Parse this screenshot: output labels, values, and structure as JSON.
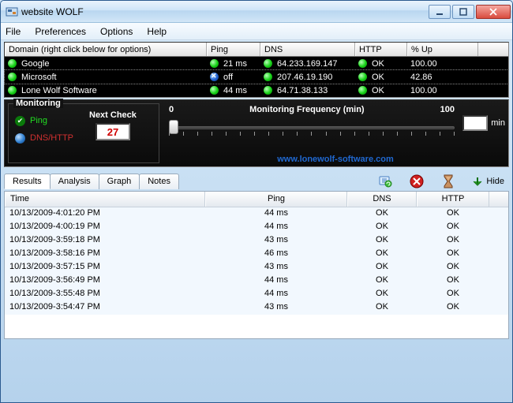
{
  "window": {
    "title": "website WOLF"
  },
  "menu": {
    "file": "File",
    "preferences": "Preferences",
    "options": "Options",
    "help": "Help"
  },
  "top_header": {
    "domain": "Domain   (right click below for options)",
    "ping": "Ping",
    "dns": "DNS",
    "http": "HTTP",
    "up": "% Up"
  },
  "sites": [
    {
      "name": "Google",
      "ping_status": "ok",
      "ping": "21 ms",
      "dns_status": "ok",
      "dns": "64.233.169.147",
      "http_status": "ok",
      "http": "OK",
      "up": "100.00",
      "selected": false
    },
    {
      "name": "Microsoft",
      "ping_status": "off",
      "ping": "off",
      "dns_status": "ok",
      "dns": "207.46.19.190",
      "http_status": "ok",
      "http": "OK",
      "up": "42.86",
      "selected": true
    },
    {
      "name": "Lone Wolf Software",
      "ping_status": "ok",
      "ping": "44 ms",
      "dns_status": "ok",
      "dns": "64.71.38.133",
      "http_status": "ok",
      "http": "OK",
      "up": "100.00",
      "selected": false
    }
  ],
  "monitoring": {
    "title": "Monitoring",
    "ping_label": "Ping",
    "dnshttp_label": "DNS/HTTP",
    "next_check_label": "Next Check",
    "next_check_value": "27"
  },
  "frequency": {
    "title": "Monitoring Frequency (min)",
    "min_label": "0",
    "max_label": "100",
    "value": "1",
    "unit": "min"
  },
  "link": "www.lonewolf-software.com",
  "tabs": {
    "results": "Results",
    "analysis": "Analysis",
    "graph": "Graph",
    "notes": "Notes"
  },
  "hide_label": "Hide",
  "results_header": {
    "time": "Time",
    "ping": "Ping",
    "dns": "DNS",
    "http": "HTTP"
  },
  "results": [
    {
      "time": "10/13/2009-4:01:20 PM",
      "ping": "44 ms",
      "dns": "OK",
      "http": "OK"
    },
    {
      "time": "10/13/2009-4:00:19 PM",
      "ping": "44 ms",
      "dns": "OK",
      "http": "OK"
    },
    {
      "time": "10/13/2009-3:59:18 PM",
      "ping": "43 ms",
      "dns": "OK",
      "http": "OK"
    },
    {
      "time": "10/13/2009-3:58:16 PM",
      "ping": "46 ms",
      "dns": "OK",
      "http": "OK"
    },
    {
      "time": "10/13/2009-3:57:15 PM",
      "ping": "43 ms",
      "dns": "OK",
      "http": "OK"
    },
    {
      "time": "10/13/2009-3:56:49 PM",
      "ping": "44 ms",
      "dns": "OK",
      "http": "OK"
    },
    {
      "time": "10/13/2009-3:55:48 PM",
      "ping": "44 ms",
      "dns": "OK",
      "http": "OK"
    },
    {
      "time": "10/13/2009-3:54:47 PM",
      "ping": "43 ms",
      "dns": "OK",
      "http": "OK"
    }
  ]
}
